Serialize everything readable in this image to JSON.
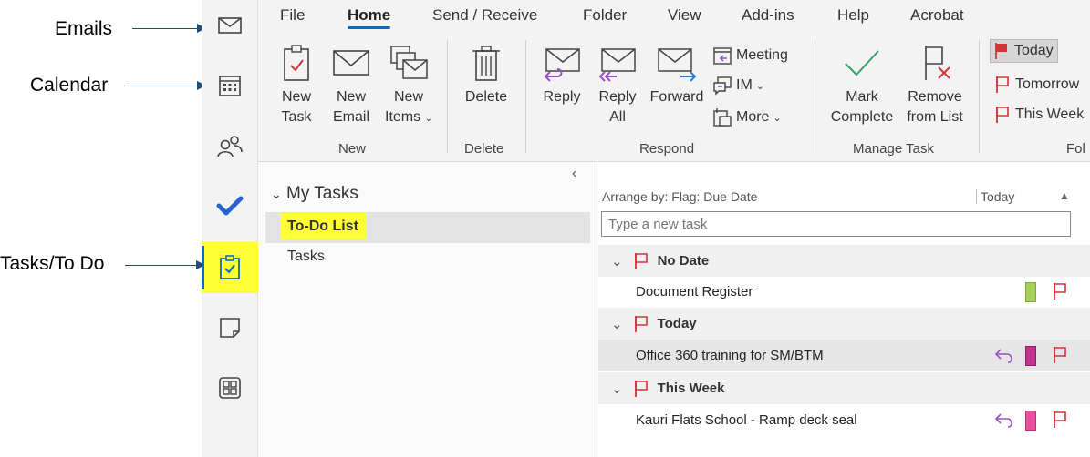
{
  "annotations": {
    "emails": "Emails",
    "calendar": "Calendar",
    "tasks": "Tasks/To Do"
  },
  "rail": {
    "items": [
      "mail-icon",
      "calendar-icon",
      "people-icon",
      "todo-check-icon",
      "tasks-icon",
      "notes-icon",
      "apps-icon"
    ],
    "active": "tasks-icon"
  },
  "ribbon": {
    "tabs": [
      "File",
      "Home",
      "Send / Receive",
      "Folder",
      "View",
      "Add-ins",
      "Help",
      "Acrobat"
    ],
    "active_tab": "Home",
    "new_group": {
      "label": "New",
      "new_task": [
        "New",
        "Task"
      ],
      "new_email": [
        "New",
        "Email"
      ],
      "new_items": [
        "New",
        "Items"
      ]
    },
    "delete_group": {
      "label": "Delete",
      "delete": "Delete"
    },
    "respond_group": {
      "label": "Respond",
      "reply": "Reply",
      "reply_all": [
        "Reply",
        "All"
      ],
      "forward": "Forward",
      "meeting": "Meeting",
      "im": "IM",
      "more": "More"
    },
    "manage_group": {
      "label": "Manage Task",
      "mark_complete": [
        "Mark",
        "Complete"
      ],
      "remove_from_list": [
        "Remove",
        "from List"
      ]
    },
    "follow_group": {
      "label": "Fol",
      "today": "Today",
      "tomorrow": "Tomorrow",
      "this_week": "This Week"
    }
  },
  "folders": {
    "section": "My Tasks",
    "items": [
      "To-Do List",
      "Tasks"
    ]
  },
  "tasklist": {
    "arrange_by": "Arrange by: Flag: Due Date",
    "arrange_col": "Today",
    "new_task_placeholder": "Type a new task",
    "groups": [
      {
        "label": "No Date",
        "tasks": [
          {
            "title": "Document Register",
            "category_color": "#a6d05c",
            "reply": false
          }
        ]
      },
      {
        "label": "Today",
        "tasks": [
          {
            "title": "Office 360 training for SM/BTM",
            "category_color": "#c2338f",
            "reply": true
          }
        ]
      },
      {
        "label": "This Week",
        "tasks": [
          {
            "title": "Kauri Flats School - Ramp deck seal",
            "category_color": "#ea4f9e",
            "reply": true
          }
        ]
      }
    ]
  },
  "colors": {
    "accent": "#0f6cbd",
    "highlight": "#ffff33",
    "flag_red": "#d13438",
    "reply_purple": "#9b4fc5",
    "check_green": "#37a266"
  }
}
